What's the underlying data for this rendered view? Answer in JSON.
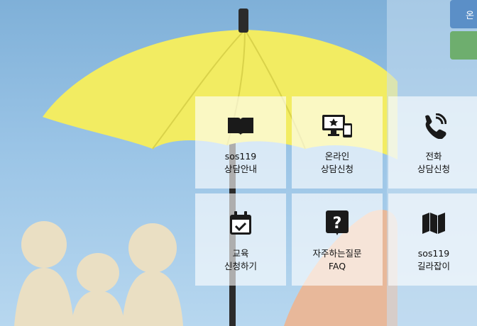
{
  "corner_buttons": {
    "top_label": "온",
    "second_label": ""
  },
  "tiles": [
    {
      "line1": "sos119",
      "line2": "상담안내",
      "icon": "book-icon"
    },
    {
      "line1": "온라인",
      "line2": "상담신청",
      "icon": "monitor-phone-icon"
    },
    {
      "line1": "전화",
      "line2": "상담신청",
      "icon": "phone-call-icon"
    },
    {
      "line1": "교육",
      "line2": "신청하기",
      "icon": "calendar-check-icon"
    },
    {
      "line1": "자주하는질문",
      "line2": "FAQ",
      "icon": "question-icon"
    },
    {
      "line1": "sos119",
      "line2": "길라잡이",
      "icon": "map-icon"
    }
  ],
  "colors": {
    "sky": "#8fbce2",
    "umbrella": "#f2ec62",
    "tile_bg": "rgba(255,255,255,0.62)",
    "icon": "#1a1a1a"
  }
}
